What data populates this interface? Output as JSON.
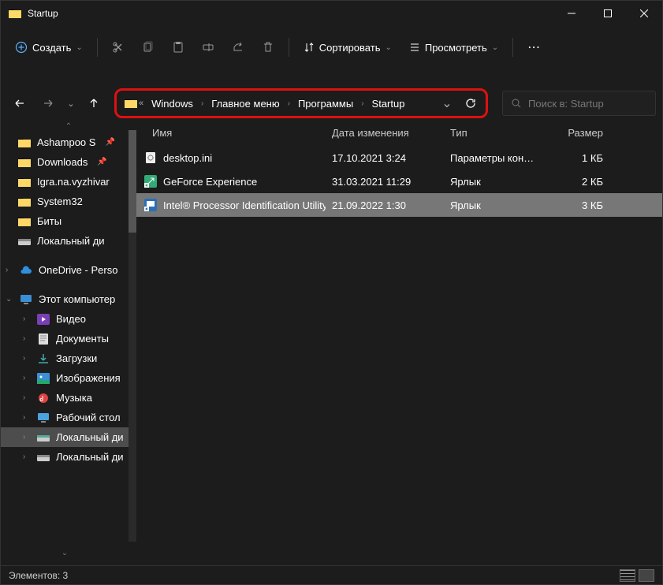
{
  "window": {
    "title": "Startup"
  },
  "toolbar": {
    "new_label": "Создать",
    "sort_label": "Сортировать",
    "view_label": "Просмотреть"
  },
  "breadcrumb": {
    "items": [
      "Windows",
      "Главное меню",
      "Программы",
      "Startup"
    ]
  },
  "search": {
    "placeholder": "Поиск в: Startup"
  },
  "sidebar": {
    "quick": [
      {
        "label": "Ashampoo S",
        "pinned": true
      },
      {
        "label": "Downloads",
        "pinned": true
      },
      {
        "label": "Igra.na.vyzhivar",
        "pinned": false
      },
      {
        "label": "System32",
        "pinned": false
      },
      {
        "label": "Биты",
        "pinned": false
      },
      {
        "label": "Локальный ди",
        "pinned": false,
        "drive": true
      }
    ],
    "onedrive": "OneDrive - Perso",
    "thispc": {
      "label": "Этот компьютер",
      "children": [
        "Видео",
        "Документы",
        "Загрузки",
        "Изображения",
        "Музыка",
        "Рабочий стол",
        "Локальный ди",
        "Локальный ди"
      ]
    }
  },
  "columns": {
    "name": "Имя",
    "date": "Дата изменения",
    "type": "Тип",
    "size": "Размер"
  },
  "files": [
    {
      "name": "desktop.ini",
      "date": "17.10.2021 3:24",
      "type": "Параметры конф...",
      "size": "1 КБ",
      "kind": "ini"
    },
    {
      "name": "GeForce Experience",
      "date": "31.03.2021 11:29",
      "type": "Ярлык",
      "size": "2 КБ",
      "kind": "shortcut"
    },
    {
      "name": "Intel® Processor Identification Utility",
      "date": "21.09.2022 1:30",
      "type": "Ярлык",
      "size": "3 КБ",
      "kind": "shortcut",
      "selected": true
    }
  ],
  "status": {
    "items_label": "Элементов:",
    "count": "3"
  }
}
